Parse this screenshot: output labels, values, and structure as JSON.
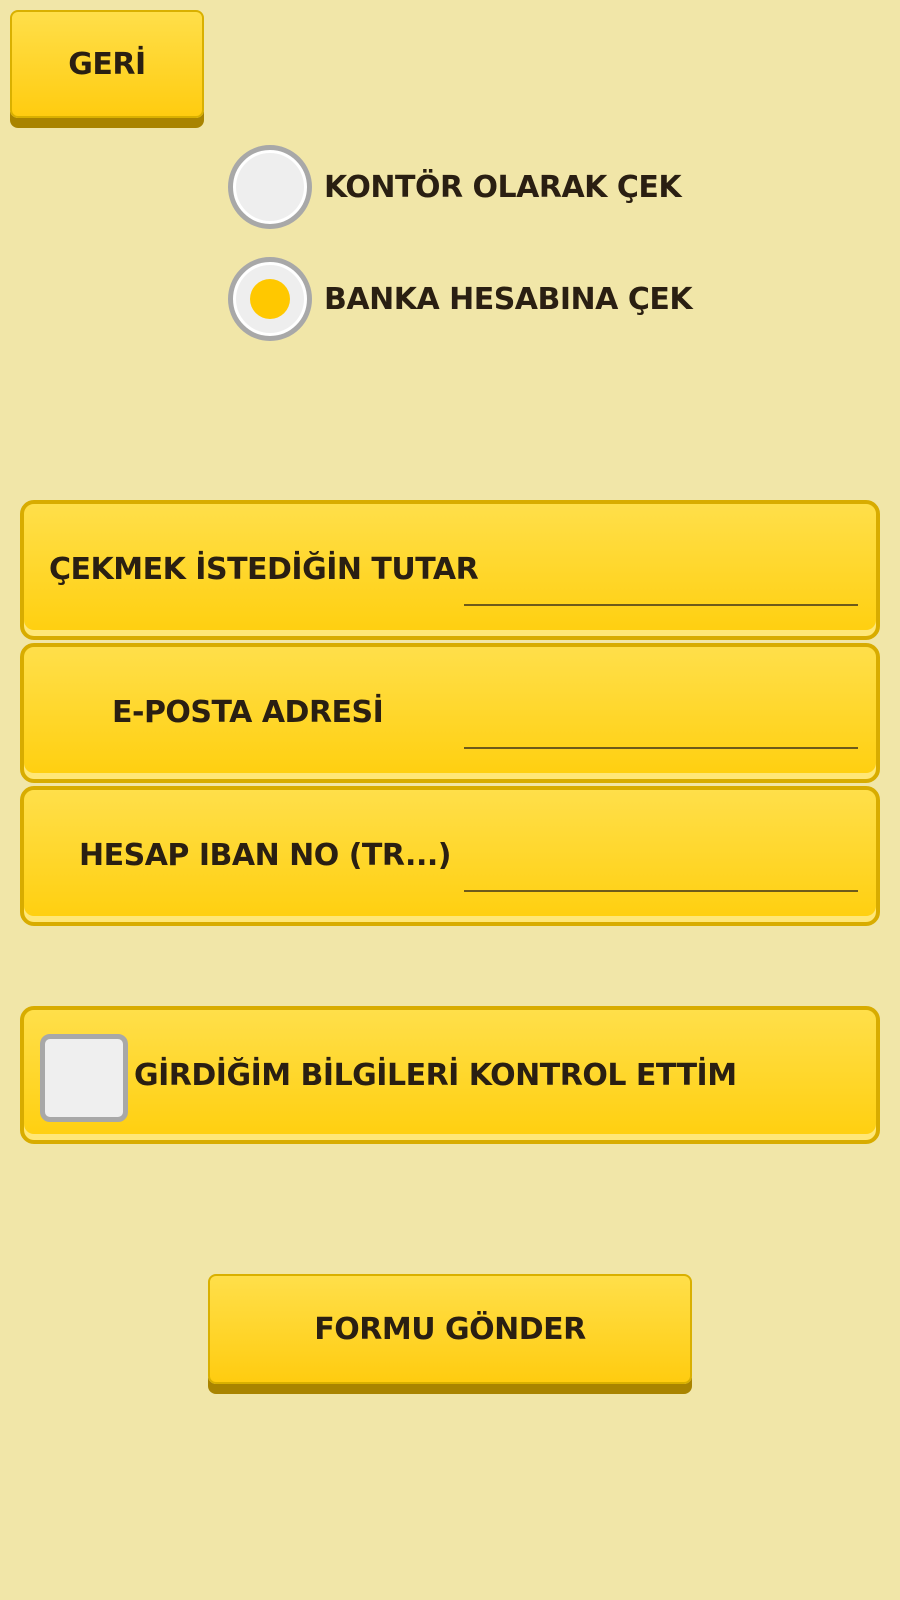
{
  "back_button": {
    "label": "GERİ"
  },
  "withdraw_options": [
    {
      "label": "KONTÖR OLARAK ÇEK",
      "selected": false
    },
    {
      "label": "BANKA HESABINA ÇEK",
      "selected": true
    }
  ],
  "form": {
    "amount": {
      "label": "ÇEKMEK İSTEDİĞİN TUTAR",
      "value": ""
    },
    "email": {
      "label": "E-POSTA ADRESİ",
      "value": ""
    },
    "iban": {
      "label": "HESAP IBAN NO (TR...)",
      "value": ""
    }
  },
  "confirm": {
    "label": "GİRDİĞİM BİLGİLERİ KONTROL ETTİM",
    "checked": false
  },
  "submit_button": {
    "label": "FORMU GÖNDER"
  },
  "colors": {
    "background": "#f1e6a8",
    "button_yellow": "#ffcf0e",
    "radio_selected": "#ffc800",
    "text": "#2a1f12"
  }
}
